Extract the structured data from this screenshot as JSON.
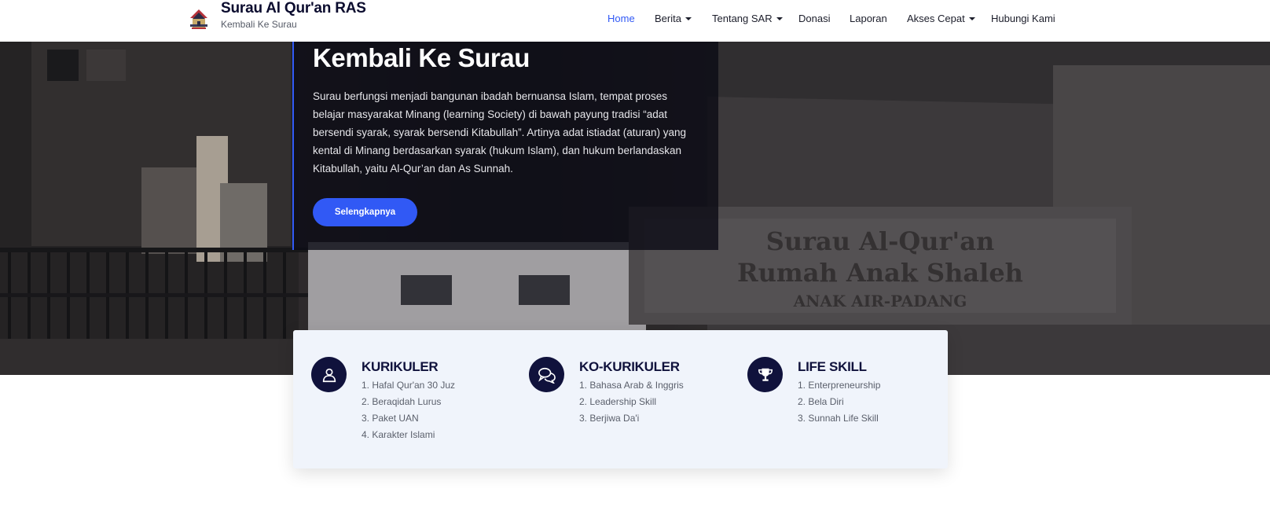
{
  "brand": {
    "title": "Surau Al Qur'an RAS",
    "subtitle": "Kembali Ke Surau",
    "logo_icon": "surau-roof-logo"
  },
  "nav": {
    "items": [
      {
        "label": "Home",
        "active": true,
        "dropdown": false
      },
      {
        "label": "Berita",
        "active": false,
        "dropdown": true
      },
      {
        "label": "Tentang SAR",
        "active": false,
        "dropdown": true
      },
      {
        "label": "Donasi",
        "active": false,
        "dropdown": false
      },
      {
        "label": "Laporan",
        "active": false,
        "dropdown": false
      },
      {
        "label": "Akses Cepat",
        "active": false,
        "dropdown": true
      },
      {
        "label": "Hubungi Kami",
        "active": false,
        "dropdown": false
      }
    ]
  },
  "hero": {
    "title": "Kembali Ke Surau",
    "text": "Surau berfungsi menjadi bangunan ibadah bernuansa Islam, tempat proses belajar masyarakat Minang (learning Society) di bawah payung tradisi “adat bersendi syarak, syarak bersendi Kitabullah”. Artinya adat istiadat (aturan) yang kental di Minang berdasarkan syarak (hukum Islam), dan hukum berlandaskan Kitabullah, yaitu Al-Qur’an dan As Sunnah.",
    "button_label": "Selengkapnya",
    "sign_text": {
      "line1": "Surau Al-Qur'an",
      "line2": "Rumah Anak Shaleh",
      "line3": "ANAK AIR-PADANG"
    }
  },
  "features": [
    {
      "icon": "user-icon",
      "title": "KURIKULER",
      "items": [
        "1. Hafal Qur'an 30 Juz",
        "2. Beraqidah Lurus",
        "3. Paket UAN",
        "4. Karakter Islami"
      ]
    },
    {
      "icon": "chat-bubbles-icon",
      "title": "KO-KURIKULER",
      "items": [
        "1. Bahasa Arab & Inggris",
        "2. Leadership Skill",
        "3. Berjiwa Da'i"
      ]
    },
    {
      "icon": "trophy-icon",
      "title": "LIFE SKILL",
      "items": [
        "1. Enterpreneurship",
        "2. Bela Diri",
        "3. Sunnah Life Skill"
      ]
    }
  ],
  "colors": {
    "accent": "#3159f5",
    "navy": "#10123c",
    "card_bg": "#f0f4fb"
  }
}
